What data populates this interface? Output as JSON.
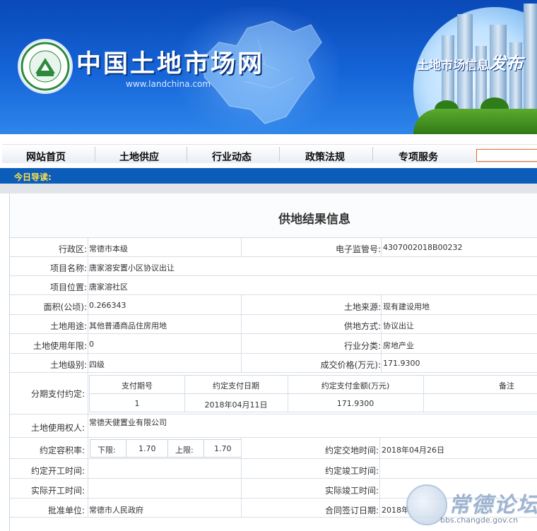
{
  "site": {
    "logo_ring_text": "中国土地市场网 WWW.LANDCHINA.COM",
    "title": "中国土地市场网",
    "url": "www.landchina.com",
    "slogan": "土地市场信息",
    "slogan_big": "发布"
  },
  "nav": {
    "items": [
      "网站首页",
      "土地供应",
      "行业动态",
      "政策法规",
      "专项服务"
    ],
    "search_value": ""
  },
  "guide": {
    "label": "今日导读:"
  },
  "page": {
    "title": "供地结果信息"
  },
  "fields": {
    "district_label": "行政区:",
    "district": "常德市本级",
    "supervision_no_label": "电子监管号:",
    "supervision_no": "4307002018B00232",
    "project_name_label": "项目名称:",
    "project_name": "唐家溶安置小区协议出让",
    "project_location_label": "项目位置:",
    "project_location": "唐家溶社区",
    "area_label": "面积(公顷):",
    "area": "0.266343",
    "land_source_label": "土地来源:",
    "land_source": "现有建设用地",
    "land_use_label": "土地用途:",
    "land_use": "其他普通商品住房用地",
    "supply_method_label": "供地方式:",
    "supply_method": "协议出让",
    "use_term_label": "土地使用年限:",
    "use_term": "0",
    "industry_label": "行业分类:",
    "industry": "房地产业",
    "land_grade_label": "土地级别:",
    "land_grade": "四级",
    "deal_price_label": "成交价格(万元):",
    "deal_price": "171.9300",
    "installment_label": "分期支付约定:",
    "land_user_label": "土地使用权人:",
    "land_user": "常德天健置业有限公司",
    "far_label": "约定容积率:",
    "far_lower_label": "下限:",
    "far_lower": "1.70",
    "far_upper_label": "上限:",
    "far_upper": "1.70",
    "handover_label": "约定交地时间:",
    "handover": "2018年04月26日",
    "start_plan_label": "约定开工时间:",
    "start_plan": "",
    "finish_plan_label": "约定竣工时间:",
    "finish_plan": "",
    "start_actual_label": "实际开工时间:",
    "start_actual": "",
    "finish_actual_label": "实际竣工时间:",
    "finish_actual": "",
    "approver_label": "批准单位:",
    "approver": "常德市人民政府",
    "contract_date_label": "合同签订日期:",
    "contract_date": "2018年"
  },
  "installments": {
    "headers": [
      "支付期号",
      "约定支付日期",
      "约定支付金额(万元)",
      "备注"
    ],
    "rows": [
      {
        "no": "1",
        "date": "2018年04月11日",
        "amount": "171.9300",
        "note": ""
      }
    ]
  },
  "watermark": {
    "title": "常德论坛",
    "url": "bbs.changde.gov.cn"
  },
  "colors": {
    "banner": "#1565d8",
    "guide_bar": "#0b5db9",
    "guide_text": "#ffe24a",
    "search_border": "#e46a2e"
  }
}
